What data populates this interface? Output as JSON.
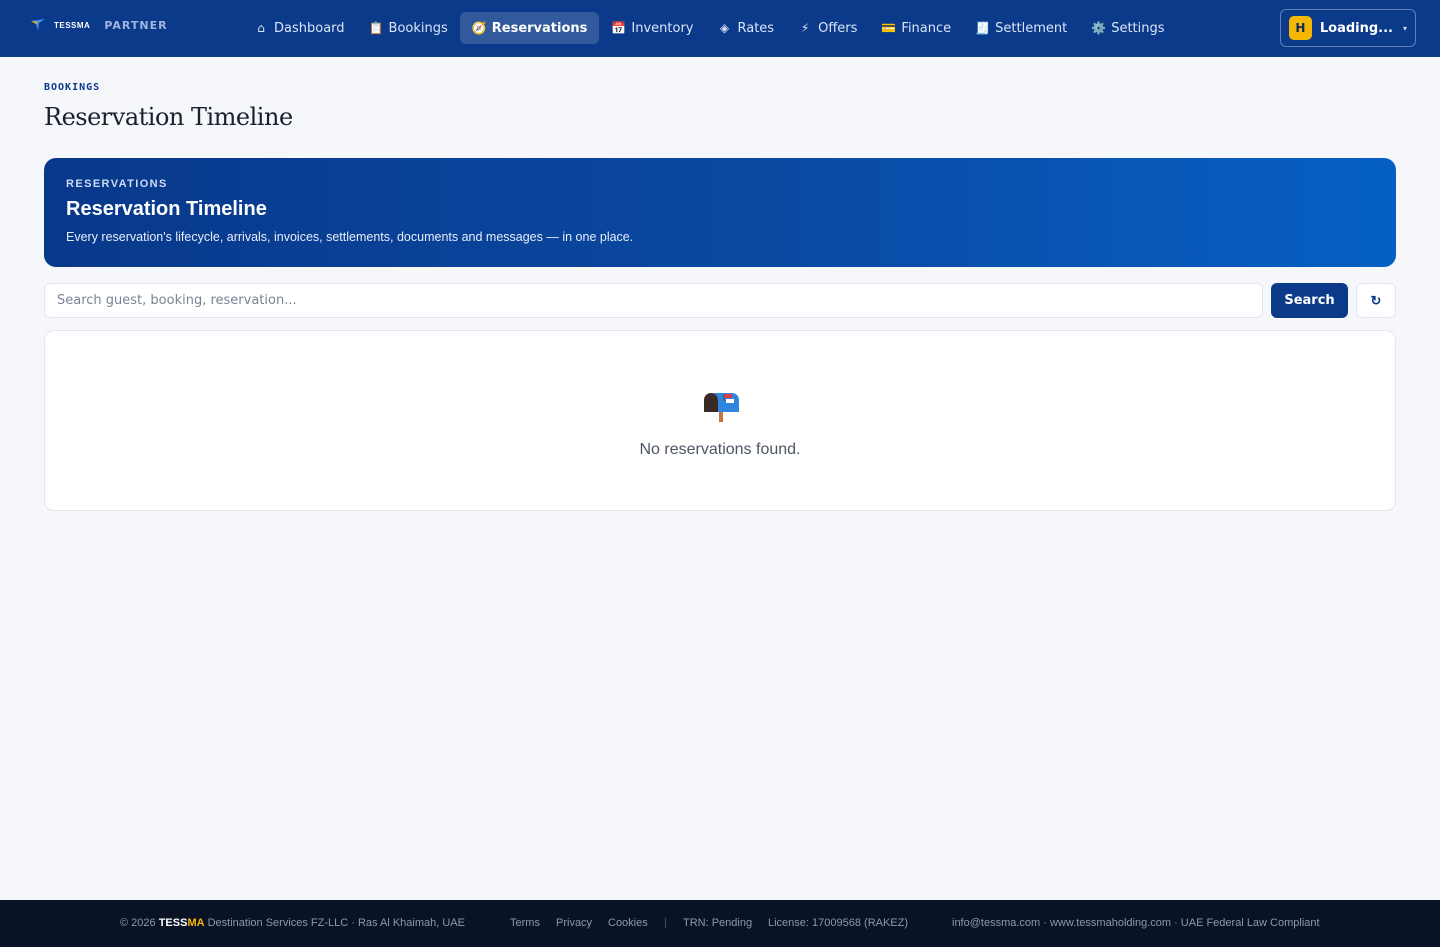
{
  "topbar": {
    "brand_name": "TESSMA",
    "brand_tag": "PARTNER",
    "nav": [
      {
        "id": "dashboard",
        "label": "Dashboard",
        "icon": "⌂",
        "icon_name": "home-icon"
      },
      {
        "id": "bookings",
        "label": "Bookings",
        "icon": "📋",
        "icon_name": "clipboard-icon"
      },
      {
        "id": "reservations",
        "label": "Reservations",
        "icon": "🧭",
        "icon_name": "compass-icon",
        "active": true
      },
      {
        "id": "inventory",
        "label": "Inventory",
        "icon": "📅",
        "icon_name": "calendar-icon"
      },
      {
        "id": "rates",
        "label": "Rates",
        "icon": "◈",
        "icon_name": "diamond-icon"
      },
      {
        "id": "offers",
        "label": "Offers",
        "icon": "⚡",
        "icon_name": "lightning-icon"
      },
      {
        "id": "finance",
        "label": "Finance",
        "icon": "💳",
        "icon_name": "credit-card-icon"
      },
      {
        "id": "settlement",
        "label": "Settlement",
        "icon": "🧾",
        "icon_name": "receipt-icon"
      },
      {
        "id": "settings",
        "label": "Settings",
        "icon": "⚙️",
        "icon_name": "gear-icon"
      }
    ],
    "user": {
      "initial": "H",
      "label": "Loading...",
      "caret": "▾"
    }
  },
  "page": {
    "eyebrow": "BOOKINGS",
    "title": "Reservation Timeline"
  },
  "hero": {
    "eyebrow": "RESERVATIONS",
    "title": "Reservation Timeline",
    "subtitle": "Every reservation's lifecycle, arrivals, invoices, settlements, documents and messages — in one place."
  },
  "search": {
    "placeholder": "Search guest, booking, reservation...",
    "value": "",
    "button_label": "Search",
    "refresh_label": "↻"
  },
  "empty_state": {
    "icon": "mailbox-icon",
    "message": "No reservations found."
  },
  "footer": {
    "copyright_prefix": "© 2026",
    "brand_part1": "TESS",
    "brand_part2": "MA",
    "company": "Destination Services FZ-LLC · Ras Al Khaimah, UAE",
    "links": [
      "Terms",
      "Privacy",
      "Cookies"
    ],
    "separator": "|",
    "trn": "TRN: Pending",
    "license": "License: 17009568 (RAKEZ)",
    "contact": "info@tessma.com · www.tessmaholding.com · UAE Federal Law Compliant"
  },
  "colors": {
    "nav_bg": "#0b3a8a",
    "accent": "#0b3a8a",
    "avatar_bg": "#f5b800",
    "page_bg": "#f5f7fb",
    "footer_bg": "#0a1226"
  }
}
